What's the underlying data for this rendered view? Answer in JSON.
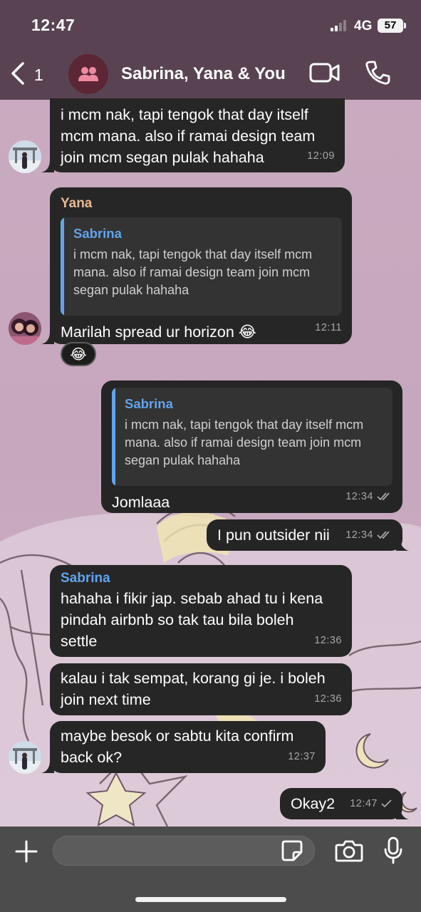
{
  "status_bar": {
    "time": "12:47",
    "network": "4G",
    "battery": "57"
  },
  "header": {
    "back_count": "1",
    "title": "Sabrina, Yana & You"
  },
  "colors": {
    "accent_blue": "#62a4ec",
    "yana_name": "#e8b894",
    "bubble": "#262626"
  },
  "messages": [
    {
      "text": "i mcm nak, tapi tengok that day itself\nmcm mana. also if ramai design team\njoin mcm segan pulak hahaha",
      "time": "12:09"
    },
    {
      "sender": "Yana",
      "quote_sender": "Sabrina",
      "quote_text": "i mcm nak, tapi tengok that day itself mcm mana. also if ramai design team join mcm segan pulak hahaha",
      "text": "Marilah spread ur horizon 😂",
      "time": "12:11",
      "reaction": "😂"
    },
    {
      "quote_sender": "Sabrina",
      "quote_text": "i mcm nak, tapi tengok that day itself mcm mana. also if ramai design team join mcm segan pulak hahaha",
      "text": "Jomlaaa",
      "time": "12:34"
    },
    {
      "text": "I pun outsider nii",
      "time": "12:34"
    },
    {
      "sender": "Sabrina",
      "text": "hahaha i fikir jap. sebab ahad tu i kena\npindah airbnb so tak tau bila boleh\nsettle",
      "time": "12:36"
    },
    {
      "text": "kalau i tak sempat, korang gi je. i boleh\njoin next time",
      "time": "12:36"
    },
    {
      "text": "maybe besok or sabtu kita confirm\nback ok?",
      "time": "12:37"
    },
    {
      "text": "Okay2",
      "time": "12:47"
    }
  ],
  "input": {
    "value": "",
    "placeholder": ""
  },
  "icons": {
    "back": "chevron-left-icon",
    "group": "group-icon",
    "video": "video-call-icon",
    "phone": "phone-icon",
    "plus": "plus-icon",
    "sticker": "sticker-icon",
    "camera": "camera-icon",
    "mic": "microphone-icon"
  }
}
